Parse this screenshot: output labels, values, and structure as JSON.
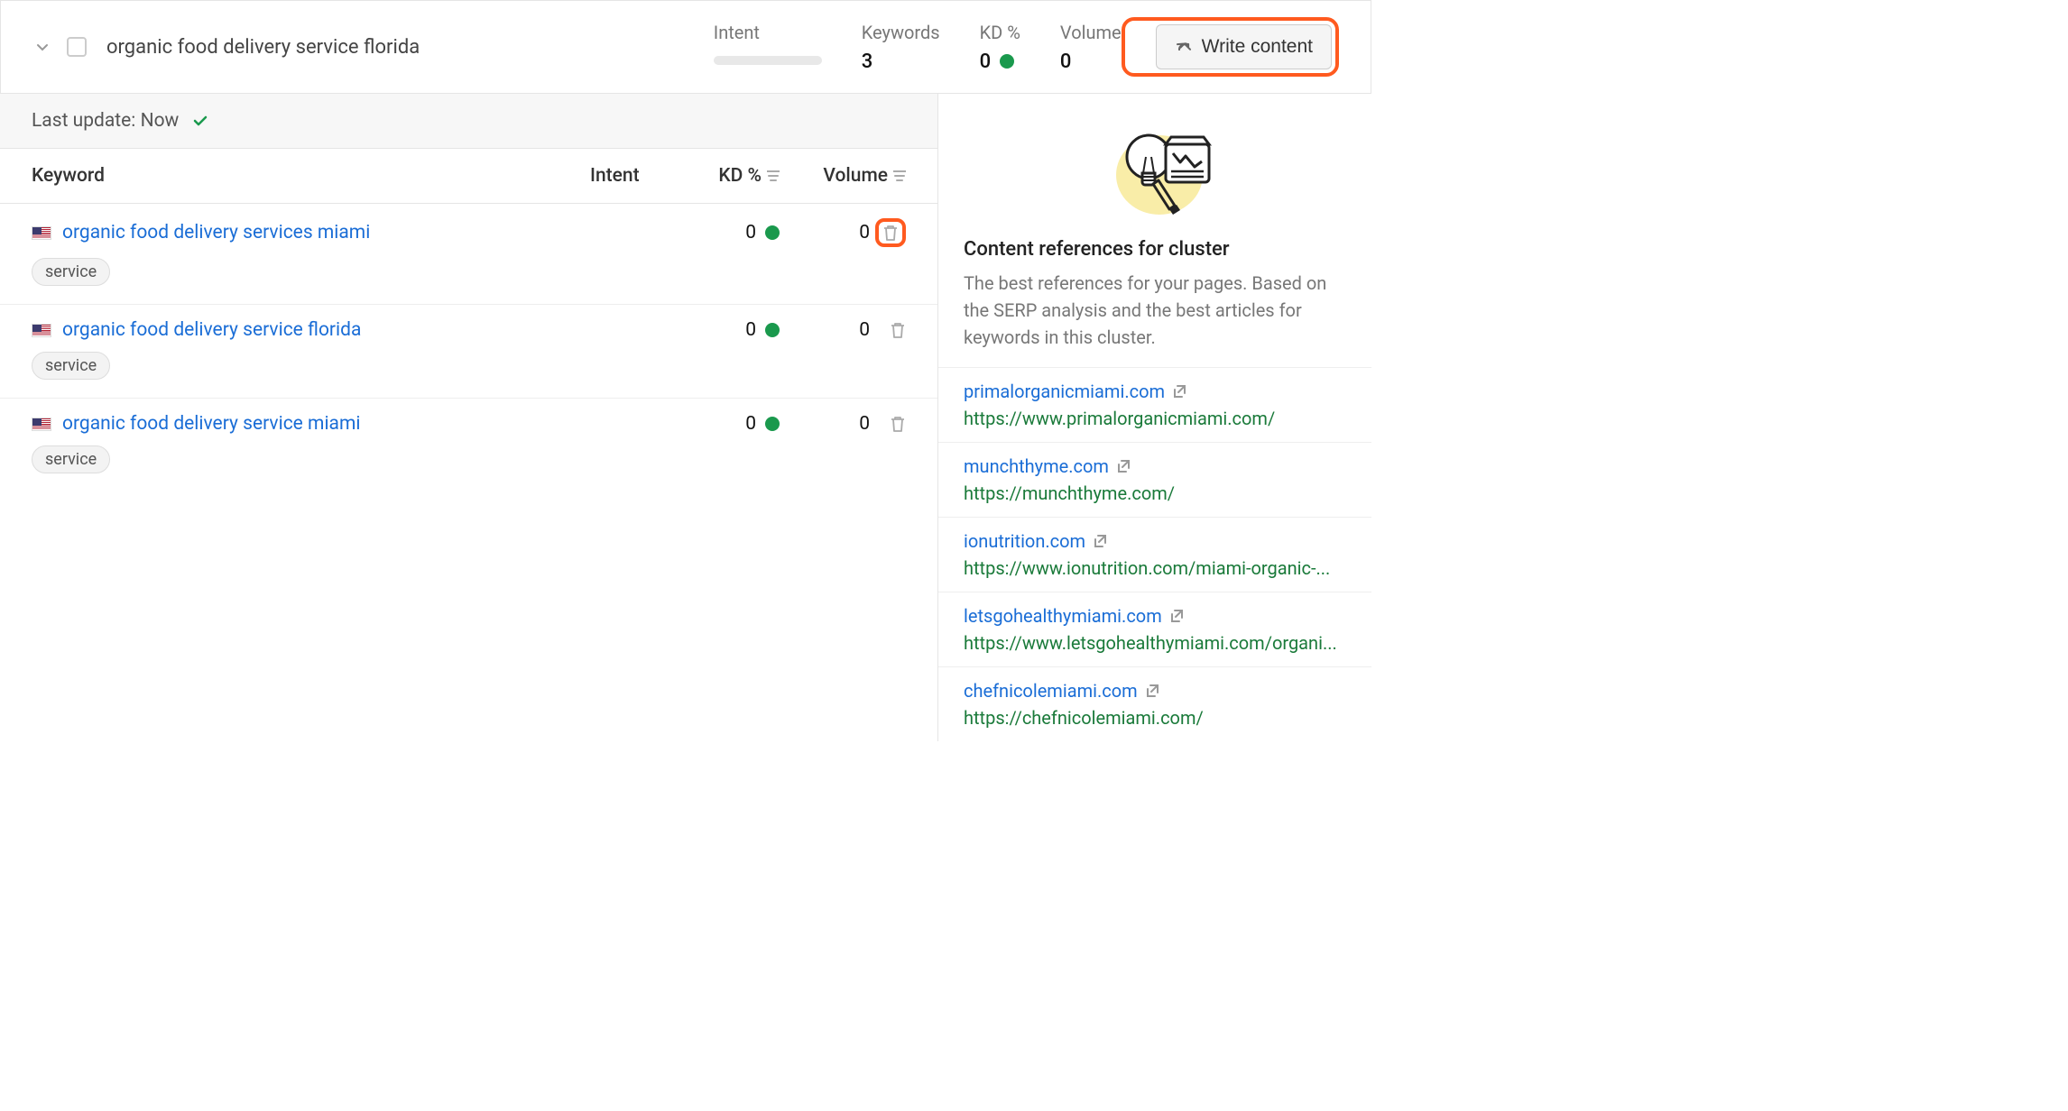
{
  "header": {
    "cluster_name": "organic food delivery service florida",
    "metrics": {
      "intent_label": "Intent",
      "keywords_label": "Keywords",
      "keywords_value": "3",
      "kd_label": "KD %",
      "kd_value": "0",
      "volume_label": "Volume",
      "volume_value": "0"
    },
    "write_button": "Write content"
  },
  "update": {
    "label": "Last update: Now"
  },
  "table": {
    "col_keyword": "Keyword",
    "col_intent": "Intent",
    "col_kd": "KD %",
    "col_volume": "Volume",
    "rows": [
      {
        "keyword": "organic food delivery services miami",
        "kd": "0",
        "volume": "0",
        "tag": "service"
      },
      {
        "keyword": "organic food delivery service florida",
        "kd": "0",
        "volume": "0",
        "tag": "service"
      },
      {
        "keyword": "organic food delivery service miami",
        "kd": "0",
        "volume": "0",
        "tag": "service"
      }
    ]
  },
  "sidebar": {
    "title": "Content references for cluster",
    "description": "The best references for your pages. Based on the SERP analysis and the best articles for keywords in this cluster.",
    "refs": [
      {
        "domain": "primalorganicmiami.com",
        "url": "https://www.primalorganicmiami.com/"
      },
      {
        "domain": "munchthyme.com",
        "url": "https://munchthyme.com/"
      },
      {
        "domain": "ionutrition.com",
        "url": "https://www.ionutrition.com/miami-organic-..."
      },
      {
        "domain": "letsgohealthymiami.com",
        "url": "https://www.letsgohealthymiami.com/organi..."
      },
      {
        "domain": "chefnicolemiami.com",
        "url": "https://chefnicolemiami.com/"
      }
    ]
  }
}
